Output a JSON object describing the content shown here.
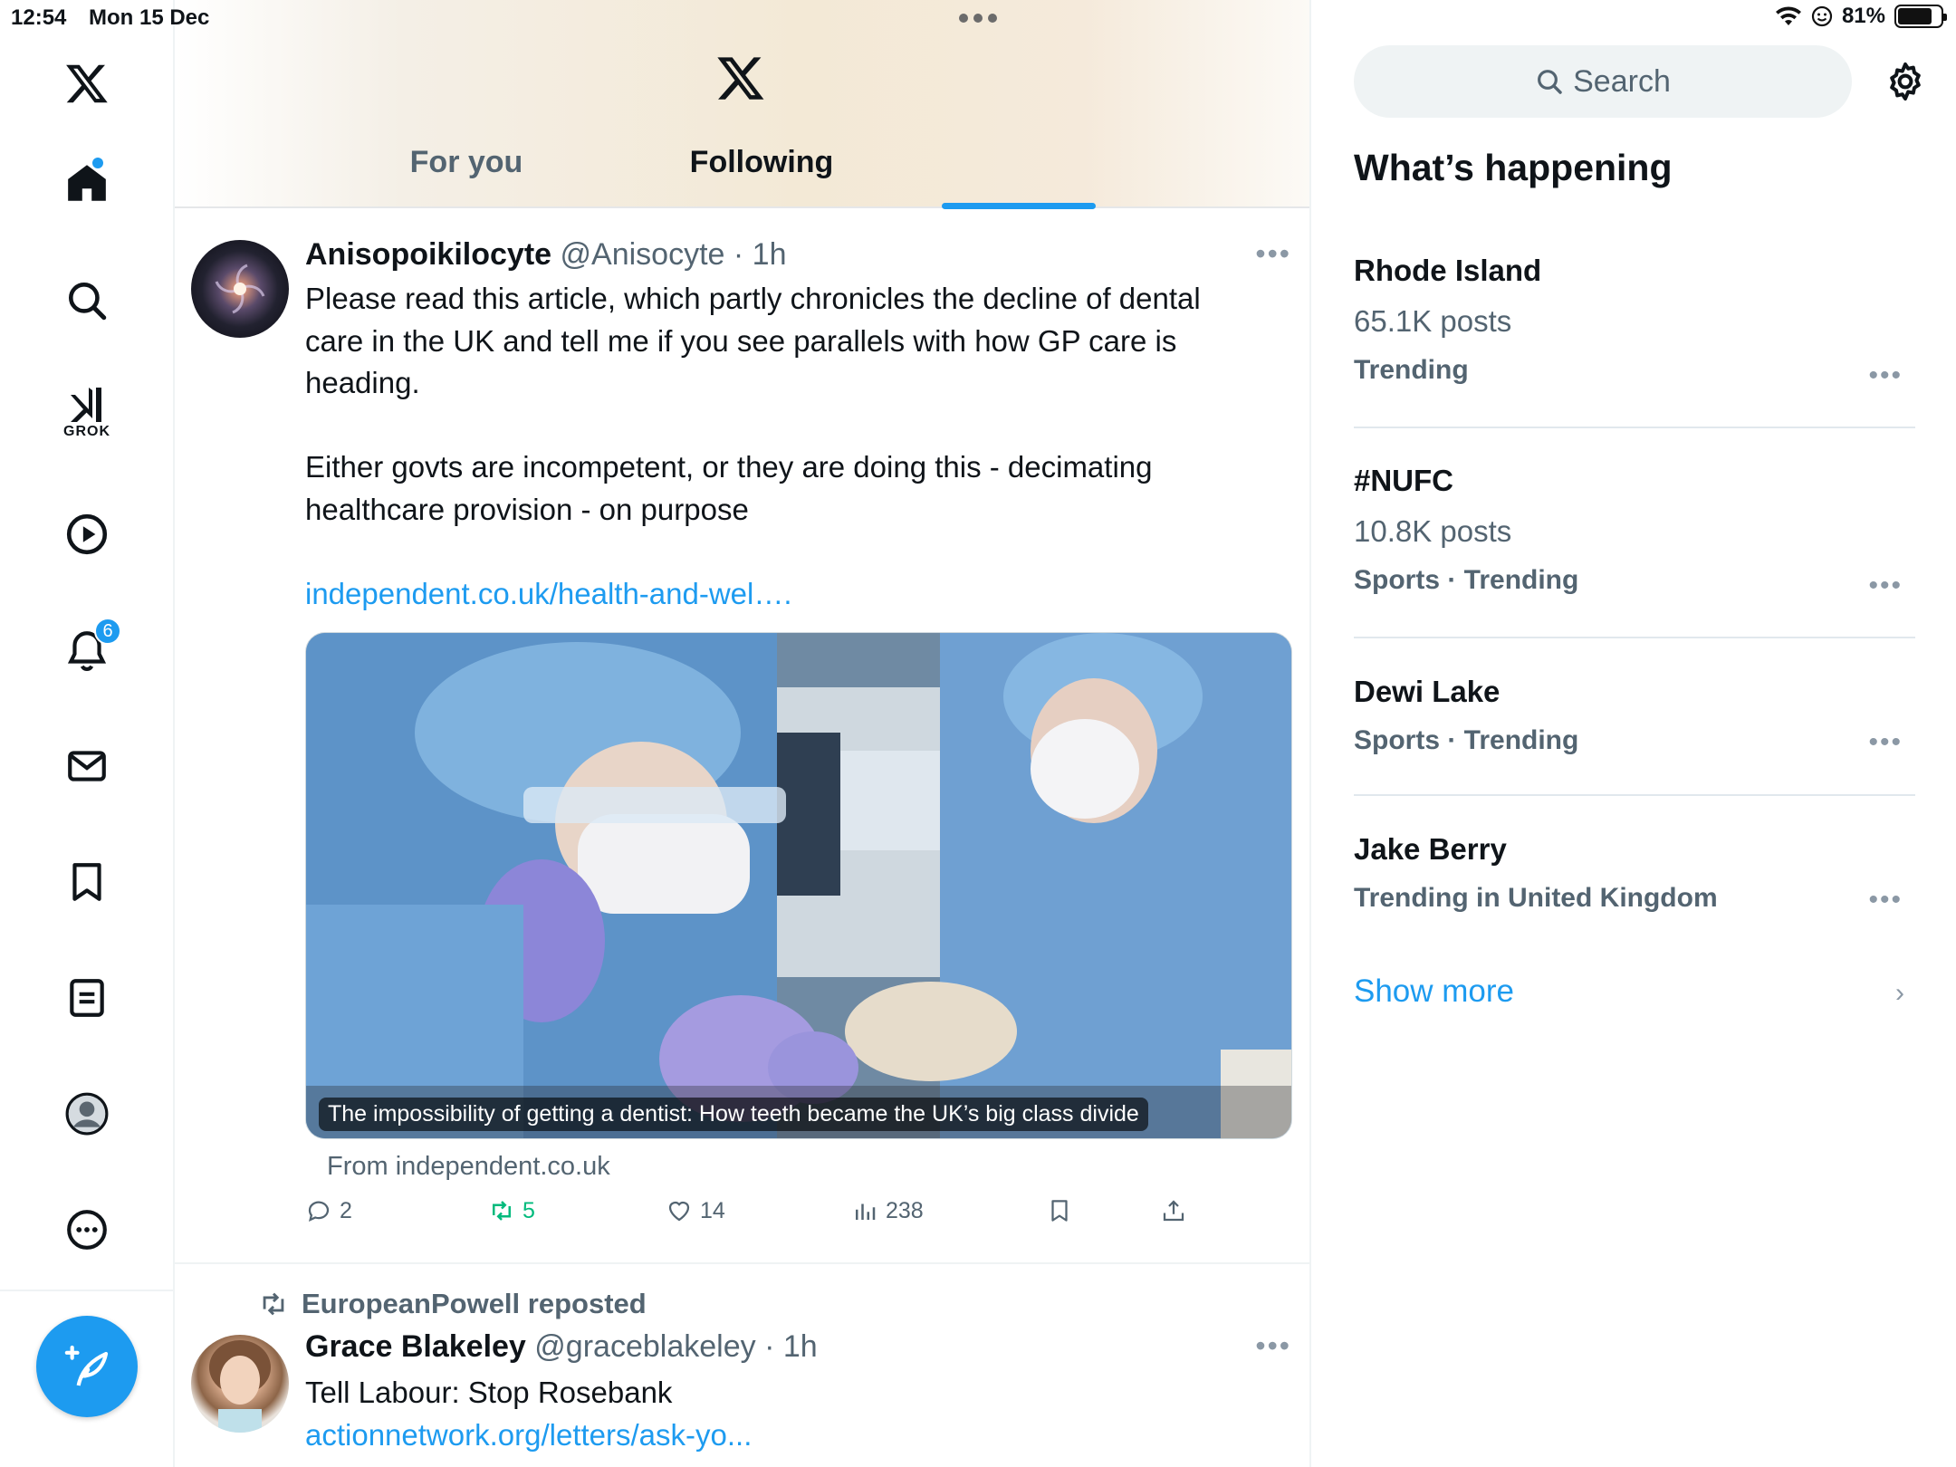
{
  "status_bar": {
    "time": "12:54",
    "date": "Mon 15 Dec",
    "battery": "81%",
    "battery_level": 0.81
  },
  "nav": {
    "notifications_badge": "6",
    "grok_label": "GROK"
  },
  "header": {
    "tabs": [
      {
        "label": "For you"
      },
      {
        "label": "Following"
      }
    ],
    "active_tab": "Following"
  },
  "post1": {
    "name": "Anisopoikilocyte",
    "handle": "@Anisocyte",
    "time": "· 1h",
    "text_line1": "Please read this article, which partly chronicles the decline of dental",
    "text_line2": "care in the UK and tell me if you see parallels with how GP care is",
    "text_line3": "heading.",
    "text_line4": "Either govts are incompetent, or they are doing this - decimating",
    "text_line5": "healthcare provision - on purpose",
    "link": "independent.co.uk/health-and-wel….",
    "media_caption": "The impossibility of getting a dentist: How teeth became the UK’s big class divide",
    "from": "From independent.co.uk",
    "replies": "2",
    "reposts": "5",
    "likes": "14",
    "views": "238"
  },
  "post2": {
    "reposted_by": "EuropeanPowell reposted",
    "name": "Grace Blakeley",
    "handle": "@graceblakeley",
    "time": "· 1h",
    "text": "Tell Labour: Stop Rosebank",
    "link": "actionnetwork.org/letters/ask-yo..."
  },
  "sidebar": {
    "search_placeholder": "Search",
    "heading": "What’s happening",
    "trends": [
      {
        "title": "Rhode Island",
        "posts": "65.1K posts",
        "category": "Trending"
      },
      {
        "title": "#NUFC",
        "posts": "10.8K posts",
        "category": "Sports · Trending"
      },
      {
        "title": "Dewi Lake",
        "category": "Sports · Trending"
      },
      {
        "title": "Jake Berry",
        "category": "Trending in United Kingdom"
      }
    ],
    "show_more": "Show more"
  },
  "colors": {
    "accent": "#1d9bf0",
    "repost_green": "#00ba7c",
    "secondary_text": "#536471"
  }
}
